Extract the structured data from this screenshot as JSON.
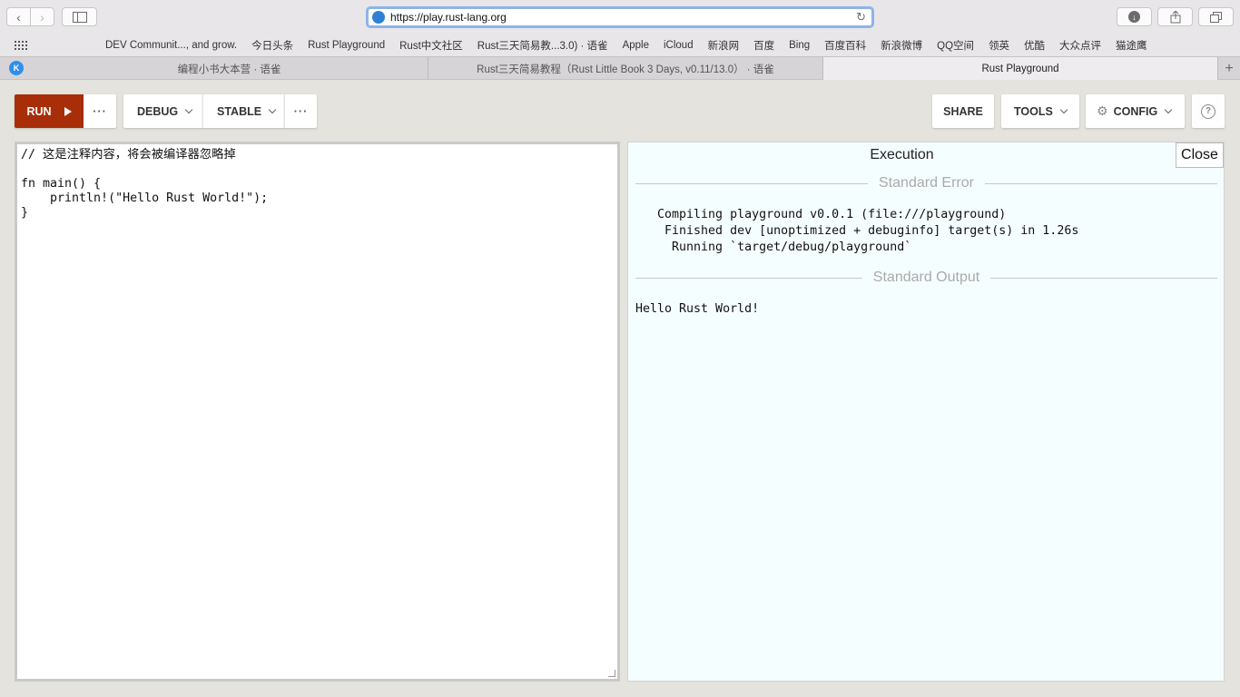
{
  "browser": {
    "url": "https://play.rust-lang.org",
    "bookmarks": [
      "DEV Communit..., and grow.",
      "今日头条",
      "Rust Playground",
      "Rust中文社区",
      "Rust三天简易教...3.0) · 语雀",
      "Apple",
      "iCloud",
      "新浪网",
      "百度",
      "Bing",
      "百度百科",
      "新浪微博",
      "QQ空间",
      "领英",
      "优酷",
      "大众点评",
      "猫途鹰"
    ],
    "tabs": [
      {
        "label": "编程小书大本营 · 语雀"
      },
      {
        "label": "Rust三天简易教程（Rust Little Book 3 Days, v0.11/13.0） · 语雀"
      },
      {
        "label": "Rust Playground"
      }
    ],
    "tab_icon_letter": "K"
  },
  "header": {
    "run_label": "RUN",
    "more_label": "···",
    "debug_label": "DEBUG",
    "stable_label": "STABLE",
    "share_label": "SHARE",
    "tools_label": "TOOLS",
    "config_label": "CONFIG",
    "help_label": "?"
  },
  "editor": {
    "lines": [
      "// 这是注释内容，将会被编译器忽略掉",
      "",
      "fn main() {",
      "    println!(\"Hello Rust World!\");",
      "}"
    ]
  },
  "output": {
    "title": "Execution",
    "close_label": "Close",
    "stderr_header": "Standard Error",
    "stderr_lines": [
      "   Compiling playground v0.0.1 (file:///playground)",
      "    Finished dev [unoptimized + debuginfo] target(s) in 1.26s",
      "     Running `target/debug/playground`"
    ],
    "stdout_header": "Standard Output",
    "stdout_lines": [
      "Hello Rust World!"
    ]
  },
  "colors": {
    "run_button": "#a72e08",
    "output_bg": "#f5fefe",
    "page_bg": "#e5e3de"
  }
}
